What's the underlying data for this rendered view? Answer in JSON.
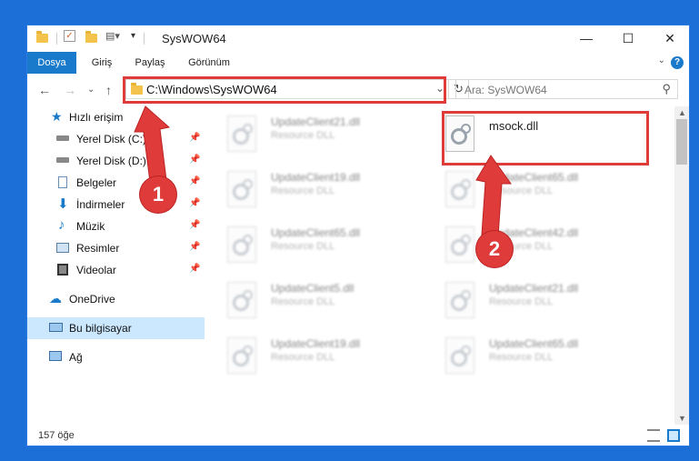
{
  "window": {
    "title": "SysWOW64"
  },
  "ribbon": {
    "tabs": [
      "Dosya",
      "Giriş",
      "Paylaş",
      "Görünüm"
    ],
    "help": "?"
  },
  "address": {
    "path": "C:\\Windows\\SysWOW64",
    "search_placeholder": "Ara: SysWOW64"
  },
  "nav": {
    "items": [
      {
        "label": "Hızlı erişim",
        "icon": "star-icon"
      },
      {
        "label": "Yerel Disk (C:)",
        "icon": "drive-icon"
      },
      {
        "label": "Yerel Disk (D:)",
        "icon": "drive-icon"
      },
      {
        "label": "Belgeler",
        "icon": "documents-icon"
      },
      {
        "label": "İndirmeler",
        "icon": "download-icon"
      },
      {
        "label": "Müzik",
        "icon": "music-icon"
      },
      {
        "label": "Resimler",
        "icon": "pictures-icon"
      },
      {
        "label": "Videolar",
        "icon": "videos-icon"
      },
      {
        "label": "OneDrive",
        "icon": "cloud-icon"
      },
      {
        "label": "Bu bilgisayar",
        "icon": "computer-icon"
      },
      {
        "label": "Ağ",
        "icon": "network-icon"
      }
    ]
  },
  "files": {
    "highlighted": {
      "name": "msock.dll"
    },
    "left": [
      {
        "name": "UpdateClient21.dll",
        "type": "Resource DLL"
      },
      {
        "name": "UpdateClient19.dll",
        "type": "Resource DLL"
      },
      {
        "name": "UpdateClient65.dll",
        "type": "Resource DLL"
      },
      {
        "name": "UpdateClient5.dll",
        "type": "Resource DLL"
      },
      {
        "name": "UpdateClient19.dll",
        "type": "Resource DLL"
      }
    ],
    "right": [
      {
        "name": "UpdateClient65.dll",
        "type": "Resource DLL"
      },
      {
        "name": "UpdateClient42.dll",
        "type": "Resource DLL"
      },
      {
        "name": "UpdateClient21.dll",
        "type": "Resource DLL"
      },
      {
        "name": "UpdateClient65.dll",
        "type": "Resource DLL"
      }
    ]
  },
  "status": {
    "count": "157 öğe"
  },
  "callouts": [
    "1",
    "2"
  ],
  "colors": {
    "accent": "#1979ca",
    "highlight_red": "#e03b3b",
    "selected_bg": "#cce8ff",
    "desktop": "#1b6fd6"
  }
}
